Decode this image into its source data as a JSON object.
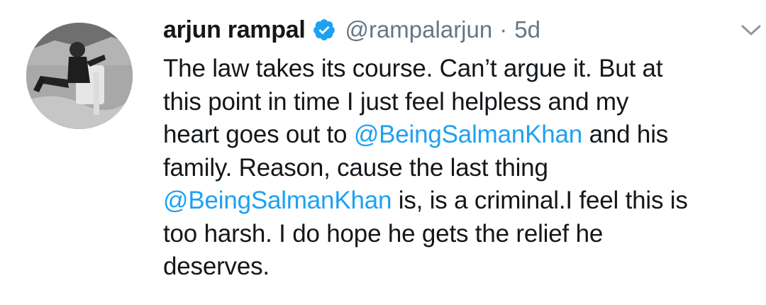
{
  "tweet": {
    "author_name": "arjun rampal",
    "handle": "@rampalarjun",
    "separator": "·",
    "time": "5d",
    "verified_icon": "verified-badge-icon",
    "menu_icon": "chevron-down-icon",
    "body": {
      "line1": "The law takes its course. Can’t argue it. But at",
      "line2": "this point in time I just feel helpless and my",
      "line3_prefix": "heart goes out to ",
      "mention1": "@BeingSalmanKhan",
      "line3_suffix": " and his",
      "line4": "family. Reason, cause the last thing",
      "mention2": "@BeingSalmanKhan",
      "line5_suffix": " is, is a criminal.I feel this is",
      "line6": "too harsh. I do hope he gets the relief he",
      "line7": "deserves."
    }
  },
  "colors": {
    "text": "#14171a",
    "secondary": "#657786",
    "link": "#1da1f2",
    "verified": "#1da1f2"
  }
}
